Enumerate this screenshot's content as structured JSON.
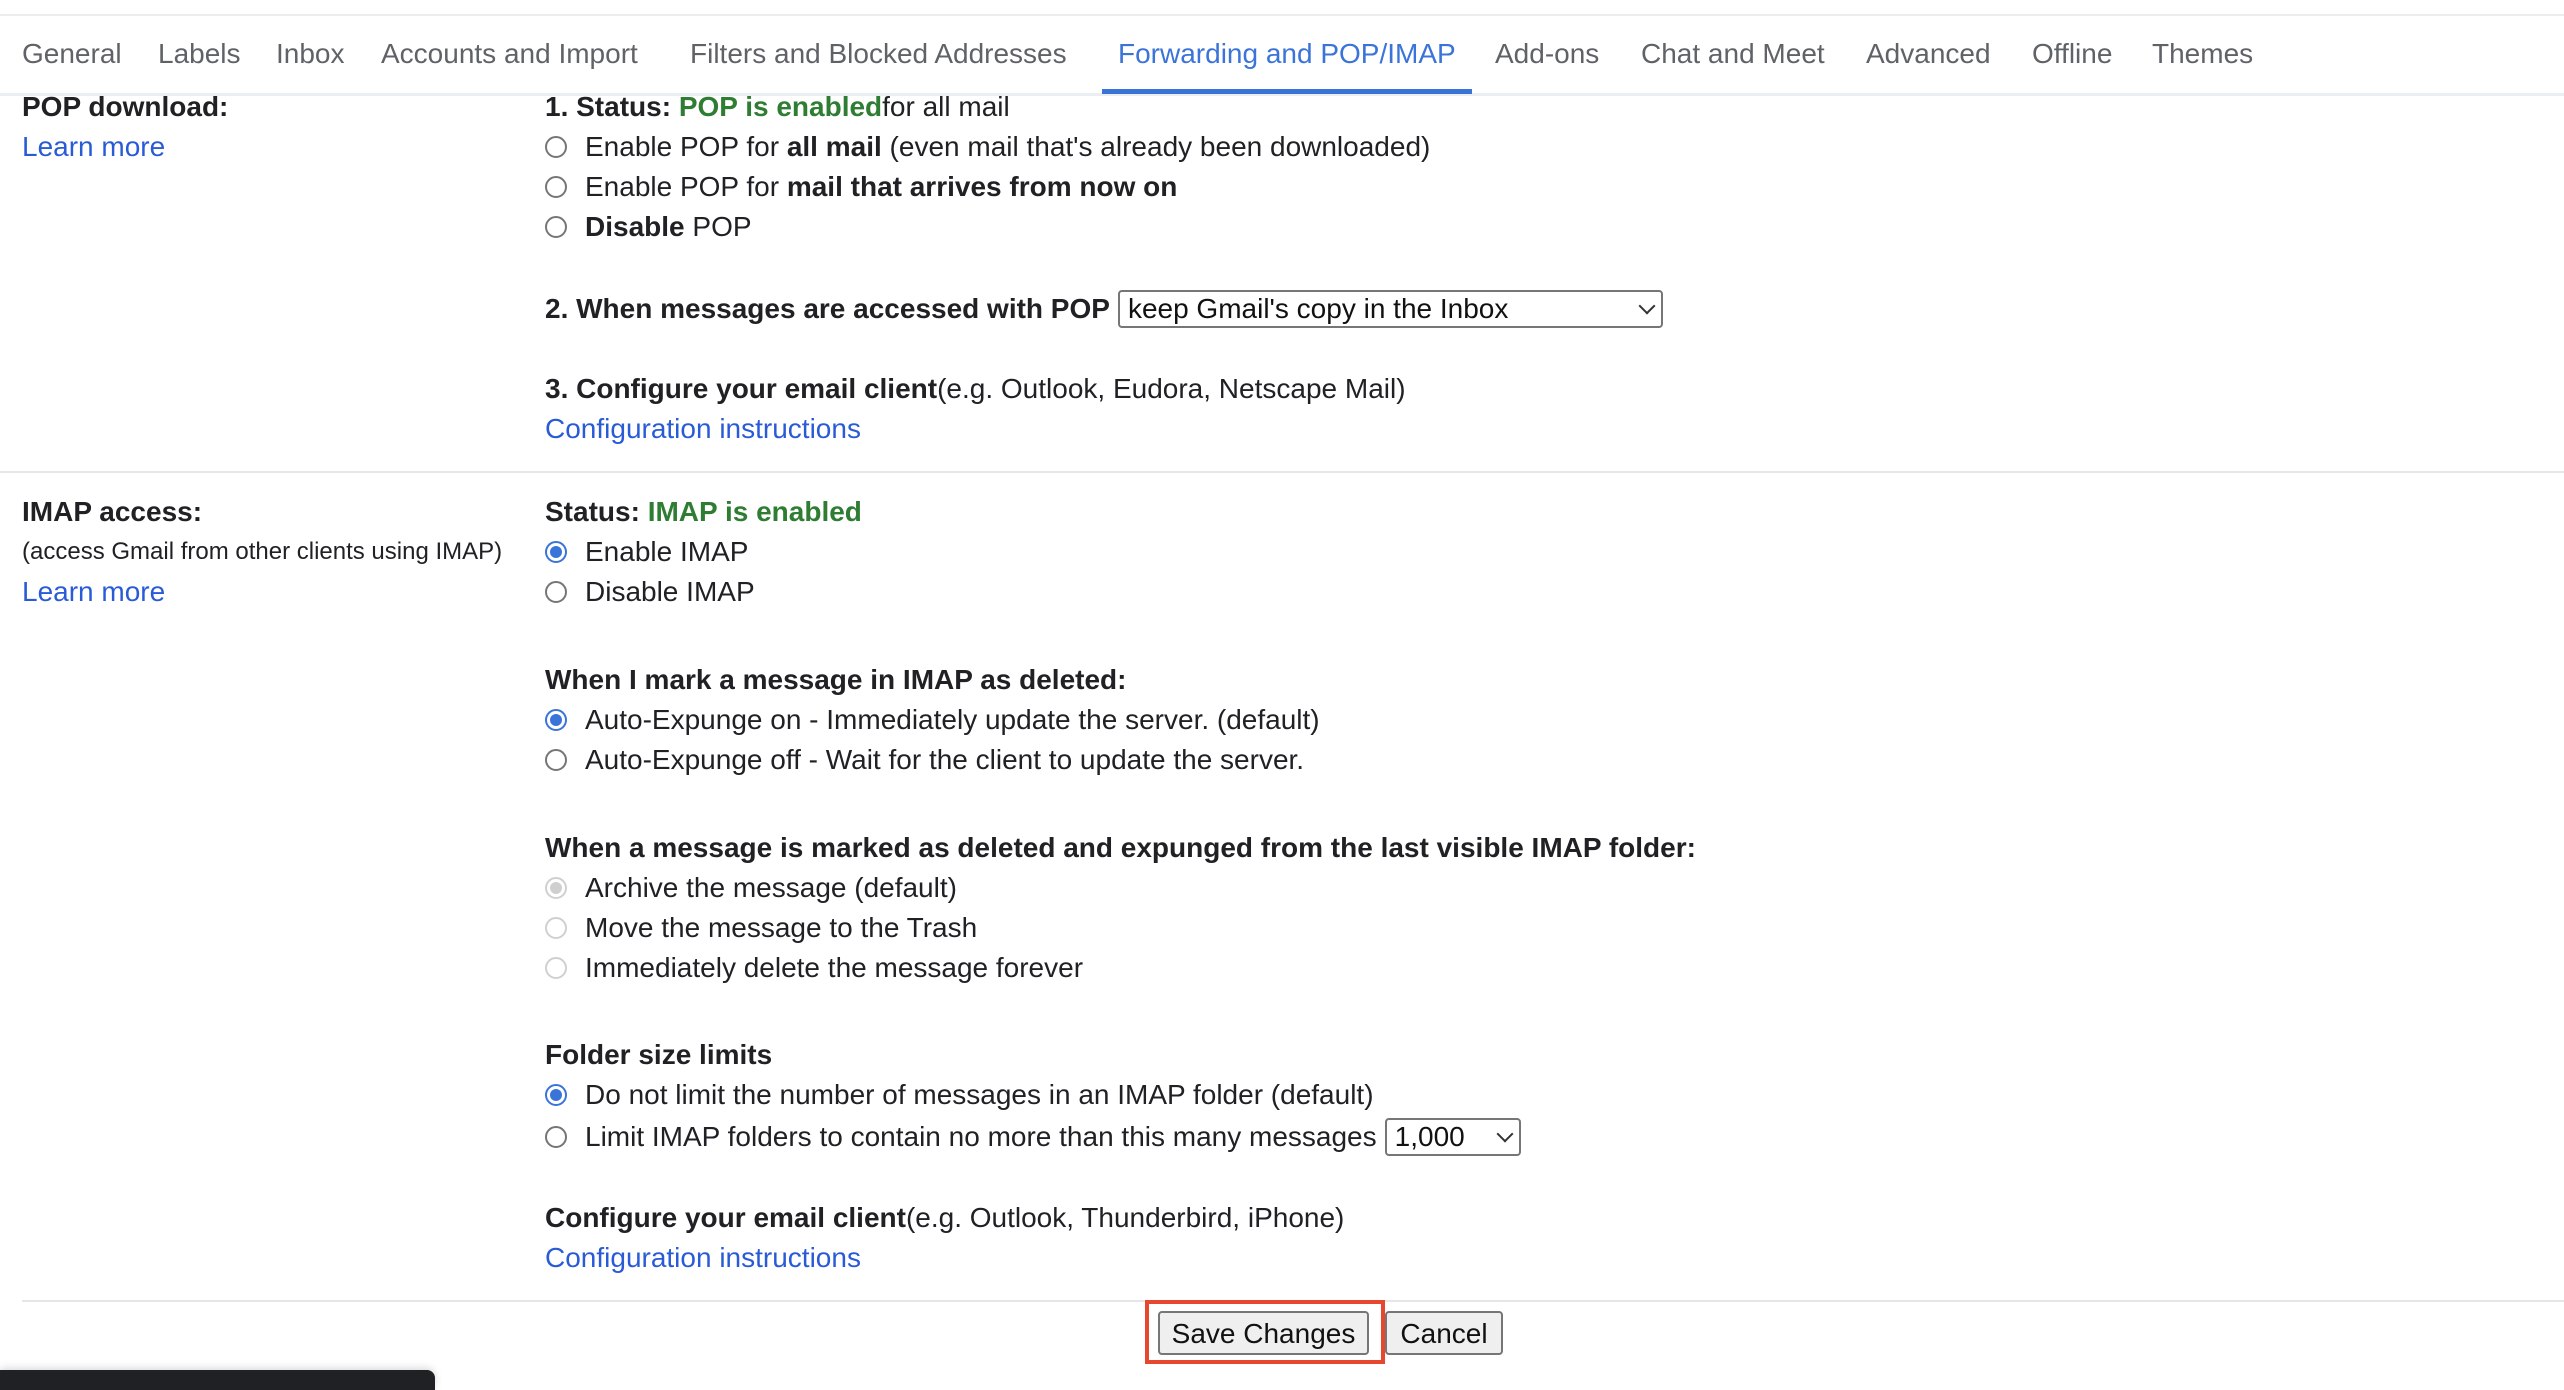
{
  "tabs": [
    {
      "label": "General",
      "active": false
    },
    {
      "label": "Labels",
      "active": false
    },
    {
      "label": "Inbox",
      "active": false
    },
    {
      "label": "Accounts and Import",
      "active": false
    },
    {
      "label": "Filters and Blocked Addresses",
      "active": false
    },
    {
      "label": "Forwarding and POP/IMAP",
      "active": true
    },
    {
      "label": "Add-ons",
      "active": false
    },
    {
      "label": "Chat and Meet",
      "active": false
    },
    {
      "label": "Advanced",
      "active": false
    },
    {
      "label": "Offline",
      "active": false
    },
    {
      "label": "Themes",
      "active": false
    }
  ],
  "colors": {
    "accent": "#3b74d9",
    "link": "#2a5bd7",
    "status_green": "#2e7d32",
    "highlight_red": "#e8472f"
  },
  "pop": {
    "title": "POP download:",
    "learn_more": "Learn more",
    "status_prefix": "1. Status: ",
    "status_value": "POP is enabled",
    "status_suffix": " for all mail",
    "options": [
      {
        "pre": "Enable POP for ",
        "bold": "all mail",
        "post": " (even mail that's already been downloaded)",
        "checked": false
      },
      {
        "pre": "Enable POP for ",
        "bold": "mail that arrives from now on",
        "post": "",
        "checked": false
      },
      {
        "pre": "",
        "bold": "Disable",
        "post": " POP",
        "checked": false
      }
    ],
    "when_accessed_label": "2. When messages are accessed with POP",
    "when_accessed_value": "keep Gmail's copy in the Inbox",
    "configure_bold": "3. Configure your email client",
    "configure_rest": " (e.g. Outlook, Eudora, Netscape Mail)",
    "config_link": "Configuration instructions"
  },
  "imap": {
    "title": "IMAP access:",
    "subtitle": "(access Gmail from other clients using IMAP)",
    "learn_more": "Learn more",
    "status_prefix": "Status: ",
    "status_value": "IMAP is enabled",
    "access_options": [
      {
        "label": "Enable IMAP",
        "checked": true
      },
      {
        "label": "Disable IMAP",
        "checked": false
      }
    ],
    "deleted_header": "When I mark a message in IMAP as deleted:",
    "deleted_options": [
      {
        "label": "Auto-Expunge on - Immediately update the server. (default)",
        "checked": true
      },
      {
        "label": "Auto-Expunge off - Wait for the client to update the server.",
        "checked": false
      }
    ],
    "expunged_header": "When a message is marked as deleted and expunged from the last visible IMAP folder:",
    "expunged_options": [
      {
        "label": "Archive the message (default)",
        "checked": true,
        "disabled": true
      },
      {
        "label": "Move the message to the Trash",
        "checked": false,
        "disabled": true
      },
      {
        "label": "Immediately delete the message forever",
        "checked": false,
        "disabled": true
      }
    ],
    "folder_header": "Folder size limits",
    "folder_options": [
      {
        "label": "Do not limit the number of messages in an IMAP folder (default)",
        "checked": true
      },
      {
        "label": "Limit IMAP folders to contain no more than this many messages",
        "checked": false
      }
    ],
    "folder_limit_value": "1,000",
    "configure_bold": "Configure your email client",
    "configure_rest": " (e.g. Outlook, Thunderbird, iPhone)",
    "config_link": "Configuration instructions"
  },
  "footer": {
    "save_label": "Save Changes",
    "cancel_label": "Cancel"
  }
}
